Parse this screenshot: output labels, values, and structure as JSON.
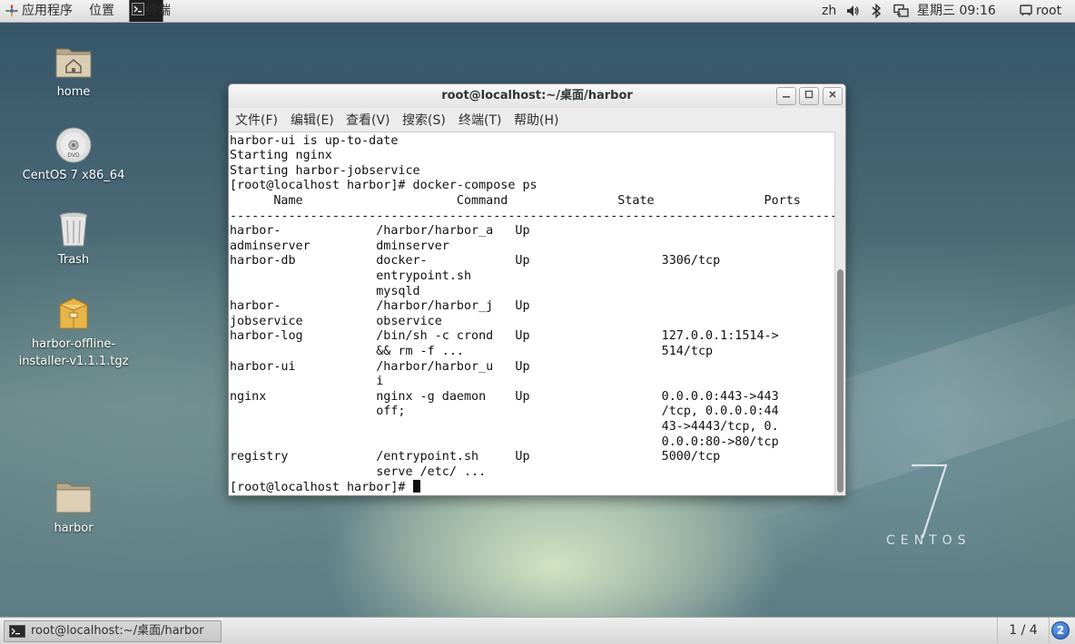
{
  "top_panel": {
    "applications_label": "应用程序",
    "places_label": "位置",
    "terminal_label": "终端",
    "input_method": "zh",
    "datetime": "星期三 09:16",
    "user": "root"
  },
  "desktop": {
    "icons": [
      {
        "label": "home",
        "icon": "home-folder-icon"
      },
      {
        "label": "CentOS 7 x86_64",
        "icon": "dvd-icon"
      },
      {
        "label": "Trash",
        "icon": "trash-icon"
      },
      {
        "label": "harbor-offline-installer-v1.1.1.tgz",
        "label_line1": "harbor-offline-",
        "label_line2": "installer-v1.1.1.tgz",
        "icon": "archive-icon"
      },
      {
        "label": "harbor",
        "icon": "folder-icon"
      }
    ],
    "watermark_number": "7",
    "watermark_text": "CENTOS"
  },
  "terminal": {
    "title": "root@localhost:~/桌面/harbor",
    "menu": [
      "文件(F)",
      "编辑(E)",
      "查看(V)",
      "搜索(S)",
      "终端(T)",
      "帮助(H)"
    ],
    "lines": [
      "harbor-ui is up-to-date",
      "Starting nginx",
      "Starting harbor-jobservice",
      "[root@localhost harbor]# docker-compose ps",
      "      Name                     Command               State               Ports",
      "-------------------------------------------------------------------------------------",
      "harbor-             /harbor/harbor_a   Up",
      "adminserver         dminserver",
      "harbor-db           docker-            Up                  3306/tcp",
      "                    entrypoint.sh",
      "                    mysqld",
      "harbor-             /harbor/harbor_j   Up",
      "jobservice          observice",
      "harbor-log          /bin/sh -c crond   Up                  127.0.0.1:1514->",
      "                    && rm -f ...                           514/tcp",
      "harbor-ui           /harbor/harbor_u   Up",
      "                    i",
      "nginx               nginx -g daemon    Up                  0.0.0.0:443->443",
      "                    off;                                   /tcp, 0.0.0.0:44",
      "                                                           43->4443/tcp, 0.",
      "                                                           0.0.0:80->80/tcp",
      "registry            /entrypoint.sh     Up                  5000/tcp",
      "                    serve /etc/ ..."
    ],
    "prompt": "[root@localhost harbor]# "
  },
  "taskbar": {
    "window_label": "root@localhost:~/桌面/harbor",
    "workspace": "1 / 4",
    "notifications": "2"
  }
}
